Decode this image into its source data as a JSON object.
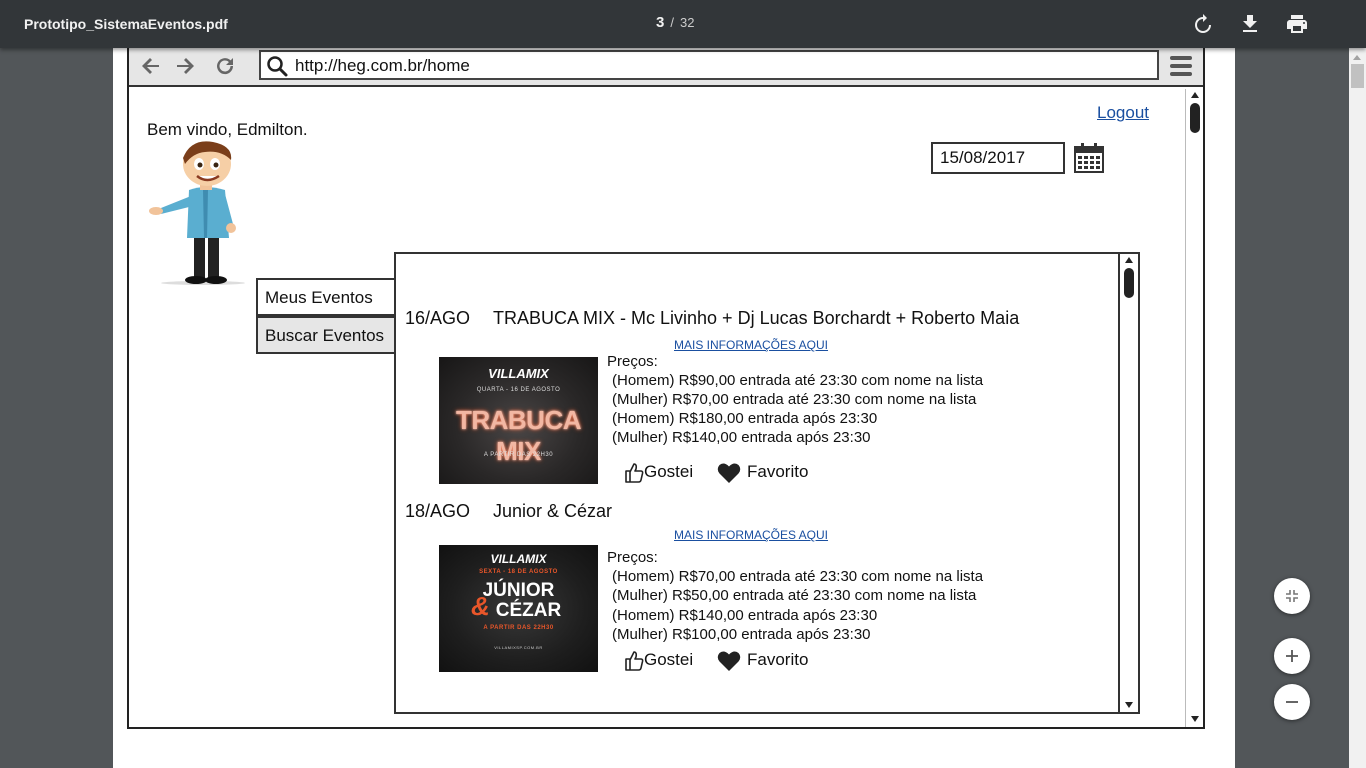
{
  "viewer": {
    "file_name": "Prototipo_SistemaEventos.pdf",
    "current_page": "3",
    "page_separator": "/",
    "total_pages": "32",
    "rotate_icon": "rotate-icon",
    "download_icon": "download-icon",
    "print_icon": "print-icon",
    "fit_icon": "fit-page-icon",
    "zoom_in_icon": "zoom-in-icon",
    "zoom_out_icon": "zoom-out-icon"
  },
  "mock_browser": {
    "url": "http://heg.com.br/home"
  },
  "header": {
    "logout_label": "Logout",
    "welcome_text": "Bem vindo, Edmilton.",
    "date_value": "15/08/2017"
  },
  "tabs": [
    {
      "label": "Meus Eventos"
    },
    {
      "label": "Buscar Eventos"
    }
  ],
  "events": [
    {
      "date": "16/AGO",
      "title": "TRABUCA MIX - Mc Livinho + Dj Lucas Borchardt + Roberto Maia",
      "more_info": "MAIS INFORMAÇÕES AQUI",
      "prices_label": "Preços:",
      "prices": [
        "(Homem) R$90,00 entrada até 23:30 com nome na lista",
        "(Mulher) R$70,00 entrada até 23:30 com nome na lista",
        "(Homem) R$180,00 entrada após 23:30",
        "(Mulher) R$140,00 entrada após 23:30"
      ],
      "like_label": "Gostei",
      "fav_label": "Favorito",
      "poster": {
        "brand": "VILLAMIX",
        "day": "QUARTA - 16 DE AGOSTO",
        "headline": "TRABUCA MIX",
        "footer": "A PARTIR DAS 22H30"
      }
    },
    {
      "date": "18/AGO",
      "title": "Junior & Cézar",
      "more_info": "MAIS INFORMAÇÕES AQUI",
      "prices_label": "Preços:",
      "prices": [
        "(Homem) R$70,00 entrada até 23:30 com nome na lista",
        "(Mulher) R$50,00 entrada até 23:30 com nome na lista",
        "(Homem) R$140,00 entrada após 23:30",
        "(Mulher) R$100,00 entrada após 23:30"
      ],
      "like_label": "Gostei",
      "fav_label": "Favorito",
      "poster": {
        "brand": "VILLAMIX",
        "day": "SEXTA - 18 DE AGOSTO",
        "headline_1": "JÚNIOR",
        "headline_amp": "&",
        "headline_2": "CÉZAR",
        "footer": "A PARTIR DAS 22H30",
        "site": "VILLAMIXSP.COM.BR"
      }
    }
  ],
  "colors": {
    "toolbar": "#323639",
    "viewer_bg": "#525659",
    "link": "#1a4fa0",
    "poster_accent": "#e8562a"
  }
}
